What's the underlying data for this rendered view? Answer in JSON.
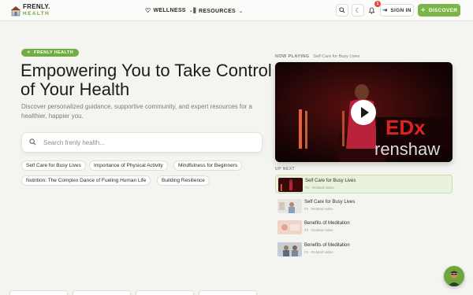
{
  "brand": {
    "line1": "FRENLY.",
    "line2": "HEALTH"
  },
  "nav": {
    "wellness": {
      "label": "WELLNESS",
      "icon": "heart-icon"
    },
    "resources": {
      "label": "RESOURCES",
      "icon": "books-icon"
    }
  },
  "header": {
    "notification_count": "1",
    "signin_label": "SIGN IN",
    "discover_label": "DISCOVER"
  },
  "hero": {
    "pill_label": "FRENLY HEALTH",
    "title": "Empowering You to Take Control of Your Health",
    "subtitle": "Discover personalized guidance, supportive community, and expert resources for a healthier, happier you."
  },
  "search": {
    "placeholder": "Search frenly health...",
    "value": ""
  },
  "chips": [
    "Self Care for Busy Lives",
    "Importance of Physical Activity",
    "Mindfulness for Beginners",
    "Nutrition: The Complex Dance of Fueling Human Life",
    "Building Resilience"
  ],
  "player": {
    "now_playing_label": "NOW PLAYING",
    "now_playing_title": "Self Care for Busy Lives",
    "up_next_label": "UP NEXT"
  },
  "playlist": [
    {
      "title": "Self Care for Busy Lives",
      "meta": "#1 · Related video",
      "active": true
    },
    {
      "title": "Self Care for Busy Lives",
      "meta": "#2 · Related video",
      "active": false
    },
    {
      "title": "Benefits of Meditation",
      "meta": "#3 · Related video",
      "active": false
    },
    {
      "title": "Benefits of Meditation",
      "meta": "#4 · Related video",
      "active": false
    }
  ],
  "colors": {
    "accent": "#7cb548",
    "accent_dark": "#6da33a",
    "background": "#f4f5f1",
    "badge": "#e04a3a"
  }
}
